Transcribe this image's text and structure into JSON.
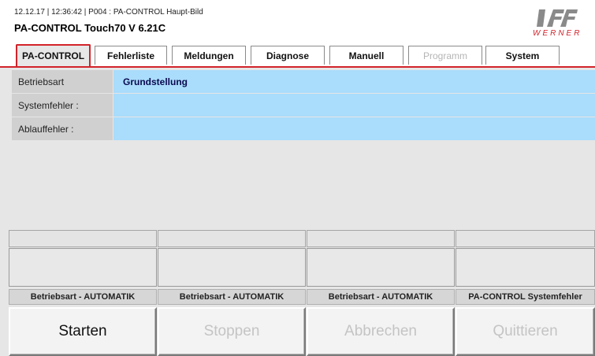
{
  "header": {
    "status_line": "12.12.17 | 12:36:42 | P004 : PA-CONTROL Haupt-Bild",
    "app_title": "PA-CONTROL Touch70 V 6.21C",
    "logo_text": "WERNER",
    "brand_color": "#d2232a"
  },
  "tabs": [
    {
      "label": "PA-CONTROL",
      "state": "active"
    },
    {
      "label": "Fehlerliste",
      "state": "normal"
    },
    {
      "label": "Meldungen",
      "state": "normal"
    },
    {
      "label": "Diagnose",
      "state": "normal"
    },
    {
      "label": "Manuell",
      "state": "normal"
    },
    {
      "label": "Programm",
      "state": "disabled"
    },
    {
      "label": "System",
      "state": "normal"
    }
  ],
  "info_rows": [
    {
      "label": "Betriebsart",
      "value": "Grundstellung"
    },
    {
      "label": "Systemfehler :",
      "value": ""
    },
    {
      "label": "Ablauffehler :",
      "value": ""
    }
  ],
  "captions": [
    "Betriebsart - AUTOMATIK",
    "Betriebsart - AUTOMATIK",
    "Betriebsart - AUTOMATIK",
    "PA-CONTROL Systemfehler"
  ],
  "actions": [
    {
      "label": "Starten",
      "enabled": true
    },
    {
      "label": "Stoppen",
      "enabled": false
    },
    {
      "label": "Abbrechen",
      "enabled": false
    },
    {
      "label": "Quittieren",
      "enabled": false
    }
  ],
  "colors": {
    "value_background": "#aadcfb",
    "label_background": "#d0d0d0",
    "panel_background": "#e6e6e6"
  }
}
